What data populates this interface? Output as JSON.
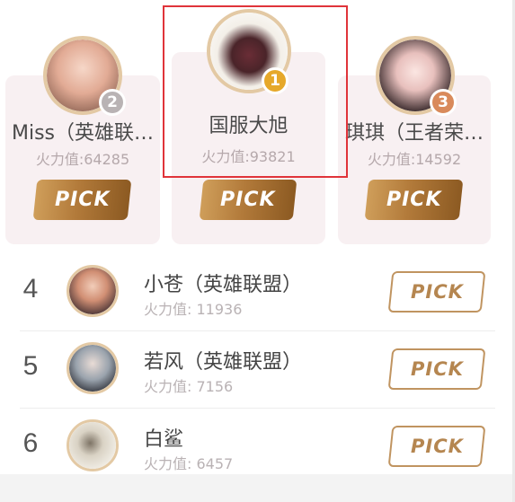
{
  "podium": [
    {
      "rank": "2",
      "name": "Miss（英雄联…",
      "score": "火力值:64285",
      "pick_label": "PICK",
      "badge_color": "#b9b3b4",
      "avatar_color": "#e9b9a6"
    },
    {
      "rank": "1",
      "name": "国服大旭",
      "score": "火力值:93821",
      "pick_label": "PICK",
      "badge_color": "#e6a82a",
      "avatar_color": "#5a3034"
    },
    {
      "rank": "3",
      "name": "琪琪（王者荣…",
      "score": "火力值:14592",
      "pick_label": "PICK",
      "badge_color": "#d98a5b",
      "avatar_color": "#f1d6d2"
    }
  ],
  "list": [
    {
      "rank": "4",
      "name": "小苍（英雄联盟）",
      "score": "火力值: 11936",
      "pick_label": "PICK",
      "avatar_color": "#c8907a"
    },
    {
      "rank": "5",
      "name": "若风（英雄联盟）",
      "score": "火力值: 7156",
      "pick_label": "PICK",
      "avatar_color": "#9aa3ad"
    },
    {
      "rank": "6",
      "name": "白鲨",
      "score": "火力值: 6457",
      "pick_label": "PICK",
      "avatar_color": "#d9d2c4"
    }
  ],
  "colors": {
    "gold_accent": "#b27a3a",
    "highlight": "#e0343a",
    "card_bg": "#f8f0f2"
  }
}
